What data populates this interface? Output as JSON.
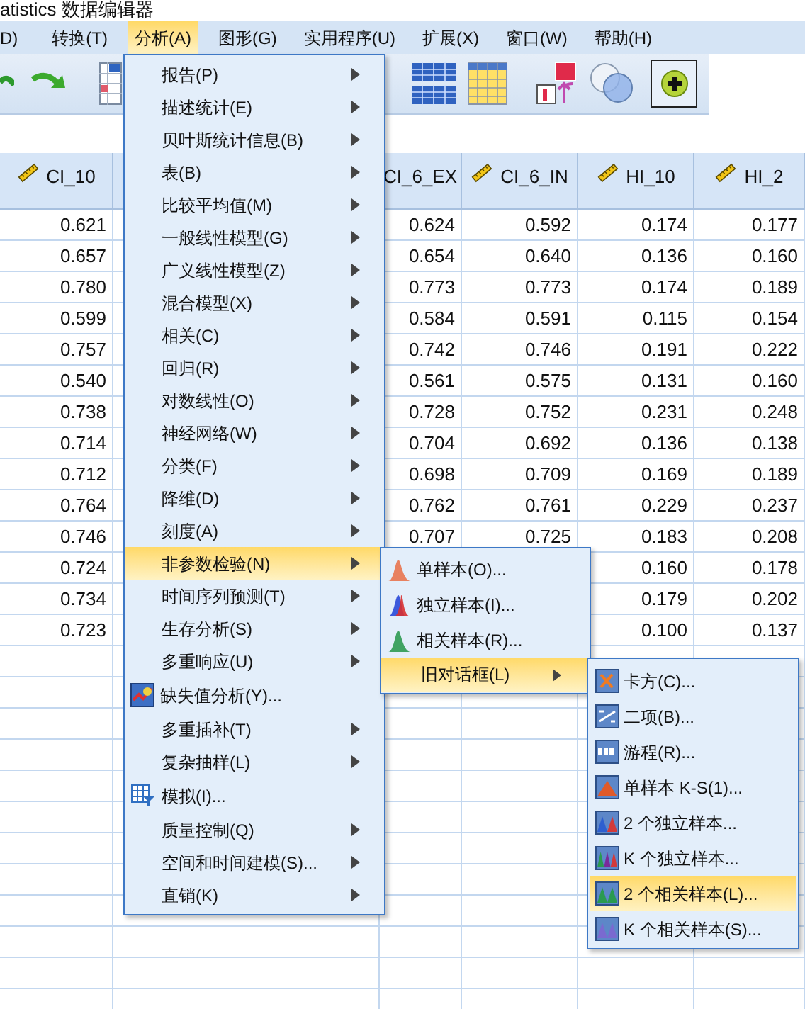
{
  "window": {
    "title": "atistics 数据编辑器"
  },
  "menu_bar": [
    {
      "label": "D)",
      "selected": false
    },
    {
      "label": "转换(T)",
      "selected": false
    },
    {
      "label": "分析(A)",
      "selected": true
    },
    {
      "label": "图形(G)",
      "selected": false
    },
    {
      "label": "实用程序(U)",
      "selected": false
    },
    {
      "label": "扩展(X)",
      "selected": false
    },
    {
      "label": "窗口(W)",
      "selected": false
    },
    {
      "label": "帮助(H)",
      "selected": false
    }
  ],
  "table": {
    "columns": [
      {
        "header": "CI_10",
        "measure_icon": true,
        "values": [
          "0.621",
          "0.657",
          "0.780",
          "0.599",
          "0.757",
          "0.540",
          "0.738",
          "0.714",
          "0.712",
          "0.764",
          "0.746",
          "0.724",
          "0.734",
          "0.723"
        ]
      },
      {
        "header": "CI_6_EX",
        "measure_icon": false,
        "values": [
          "0.624",
          "0.654",
          "0.773",
          "0.584",
          "0.742",
          "0.561",
          "0.728",
          "0.704",
          "0.698",
          "0.762",
          "0.707"
        ]
      },
      {
        "header": "CI_6_IN",
        "measure_icon": true,
        "values": [
          "0.592",
          "0.640",
          "0.773",
          "0.591",
          "0.746",
          "0.575",
          "0.752",
          "0.692",
          "0.709",
          "0.761",
          "0.725"
        ]
      },
      {
        "header": "HI_10",
        "measure_icon": true,
        "values": [
          "0.174",
          "0.136",
          "0.174",
          "0.115",
          "0.191",
          "0.131",
          "0.231",
          "0.136",
          "0.169",
          "0.229",
          "0.183",
          "0.160",
          "0.179",
          "0.100"
        ]
      },
      {
        "header": "HI_2",
        "measure_icon": true,
        "values": [
          "0.177",
          "0.160",
          "0.189",
          "0.154",
          "0.222",
          "0.160",
          "0.248",
          "0.138",
          "0.189",
          "0.237",
          "0.208",
          "0.178",
          "0.202",
          "0.137"
        ]
      }
    ]
  },
  "analyze_menu": {
    "items": [
      {
        "label": "报告(P)",
        "kind": "submenu",
        "selected": false
      },
      {
        "label": "描述统计(E)",
        "kind": "submenu",
        "selected": false
      },
      {
        "label": "贝叶斯统计信息(B)",
        "kind": "submenu",
        "selected": false
      },
      {
        "label": "表(B)",
        "kind": "submenu",
        "selected": false
      },
      {
        "label": "比较平均值(M)",
        "kind": "submenu",
        "selected": false
      },
      {
        "label": "一般线性模型(G)",
        "kind": "submenu",
        "selected": false
      },
      {
        "label": "广义线性模型(Z)",
        "kind": "submenu",
        "selected": false
      },
      {
        "label": "混合模型(X)",
        "kind": "submenu",
        "selected": false
      },
      {
        "label": "相关(C)",
        "kind": "submenu",
        "selected": false
      },
      {
        "label": "回归(R)",
        "kind": "submenu",
        "selected": false
      },
      {
        "label": "对数线性(O)",
        "kind": "submenu",
        "selected": false
      },
      {
        "label": "神经网络(W)",
        "kind": "submenu",
        "selected": false
      },
      {
        "label": "分类(F)",
        "kind": "submenu",
        "selected": false
      },
      {
        "label": "降维(D)",
        "kind": "submenu",
        "selected": false
      },
      {
        "label": "刻度(A)",
        "kind": "submenu",
        "selected": false
      },
      {
        "label": "非参数检验(N)",
        "kind": "submenu",
        "selected": true
      },
      {
        "label": "时间序列预测(T)",
        "kind": "submenu",
        "selected": false
      },
      {
        "label": "生存分析(S)",
        "kind": "submenu",
        "selected": false
      },
      {
        "label": "多重响应(U)",
        "kind": "submenu",
        "selected": false
      },
      {
        "label": "缺失值分析(Y)...",
        "kind": "command",
        "selected": false
      },
      {
        "label": "多重插补(T)",
        "kind": "submenu",
        "selected": false
      },
      {
        "label": "复杂抽样(L)",
        "kind": "submenu",
        "selected": false
      },
      {
        "label": "模拟(I)...",
        "kind": "command",
        "selected": false
      },
      {
        "label": "质量控制(Q)",
        "kind": "submenu",
        "selected": false
      },
      {
        "label": "空间和时间建模(S)...",
        "kind": "submenu",
        "selected": false
      },
      {
        "label": "直销(K)",
        "kind": "submenu",
        "selected": false
      }
    ]
  },
  "nonparametric_menu": {
    "items": [
      {
        "label": "单样本(O)...",
        "kind": "command",
        "selected": false
      },
      {
        "label": "独立样本(I)...",
        "kind": "command",
        "selected": false
      },
      {
        "label": "相关样本(R)...",
        "kind": "command",
        "selected": false
      },
      {
        "label": "旧对话框(L)",
        "kind": "submenu",
        "selected": true
      }
    ]
  },
  "legacy_dialogs_menu": {
    "items": [
      {
        "label": "卡方(C)...",
        "selected": false
      },
      {
        "label": "二项(B)...",
        "selected": false
      },
      {
        "label": "游程(R)...",
        "selected": false
      },
      {
        "label": "单样本 K-S(1)...",
        "selected": false
      },
      {
        "label": "2 个独立样本...",
        "selected": false
      },
      {
        "label": "K 个独立样本...",
        "selected": false
      },
      {
        "label": "2 个相关样本(L)...",
        "selected": true
      },
      {
        "label": "K 个相关样本(S)...",
        "selected": false
      }
    ]
  }
}
